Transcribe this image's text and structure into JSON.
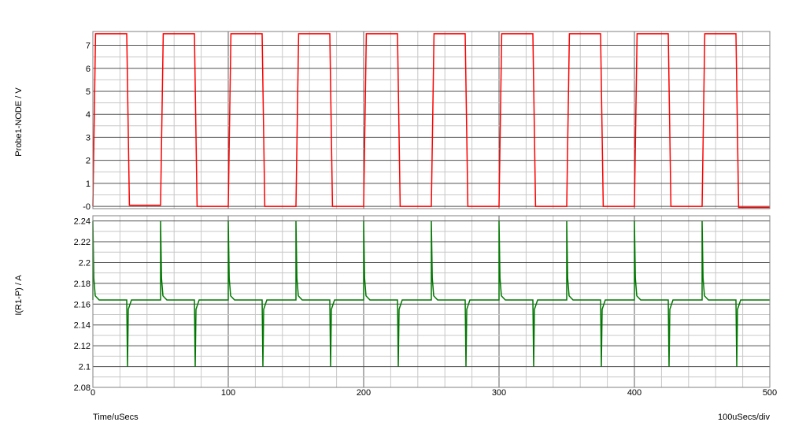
{
  "chart_data": [
    {
      "type": "line",
      "ylabel": "Probe1-NODE / V",
      "ylim": [
        -0.1,
        7.6
      ],
      "yticks": [
        0,
        1,
        2,
        3,
        4,
        5,
        6,
        7
      ],
      "ytick_labels": [
        "-0",
        "1",
        "2",
        "3",
        "4",
        "5",
        "6",
        "7"
      ],
      "grid": true,
      "series": [
        {
          "color": "#ff0000",
          "x": [
            0,
            2,
            25,
            27,
            50,
            52,
            75,
            77,
            100,
            102,
            125,
            127,
            150,
            152,
            175,
            177,
            200,
            202,
            225,
            227,
            250,
            252,
            275,
            277,
            300,
            302,
            325,
            327,
            350,
            352,
            375,
            377,
            400,
            402,
            425,
            427,
            450,
            452,
            475,
            477,
            500
          ],
          "y": [
            0,
            7.5,
            7.5,
            0.05,
            0.05,
            7.5,
            7.5,
            0.0,
            0.0,
            7.5,
            7.5,
            0.0,
            0.0,
            7.5,
            7.5,
            0.0,
            0.0,
            7.5,
            7.5,
            0.0,
            0.0,
            7.5,
            7.5,
            0.0,
            0.0,
            7.5,
            7.5,
            0.0,
            0.0,
            7.5,
            7.5,
            0.0,
            0.0,
            7.5,
            7.5,
            0.0,
            0.0,
            7.5,
            7.5,
            -0.05,
            -0.05
          ]
        }
      ]
    },
    {
      "type": "line",
      "ylabel": "I(R1-P) / A",
      "ylim": [
        2.08,
        2.245
      ],
      "yticks": [
        2.08,
        2.1,
        2.12,
        2.14,
        2.16,
        2.18,
        2.2,
        2.22,
        2.24
      ],
      "ytick_labels": [
        "2.08",
        "2.1",
        "2.12",
        "2.14",
        "2.16",
        "2.18",
        "2.2",
        "2.22",
        "2.24"
      ],
      "grid": true,
      "baseline": 2.164,
      "series": [
        {
          "color": "#007700",
          "rising_edges_x": [
            0,
            50,
            100,
            150,
            200,
            250,
            300,
            350,
            400,
            450
          ],
          "spike_peak": 2.24,
          "falling_edges_x": [
            25,
            75,
            125,
            175,
            225,
            275,
            325,
            375,
            425,
            475
          ],
          "dip_min": 2.1
        }
      ]
    }
  ],
  "xaxis": {
    "label": "Time/uSecs",
    "division_label": "100uSecs/div",
    "xlim": [
      0,
      500
    ],
    "ticks": [
      0,
      100,
      200,
      300,
      400,
      500
    ],
    "tick_labels": [
      "0",
      "100",
      "200",
      "300",
      "400",
      "500"
    ]
  }
}
